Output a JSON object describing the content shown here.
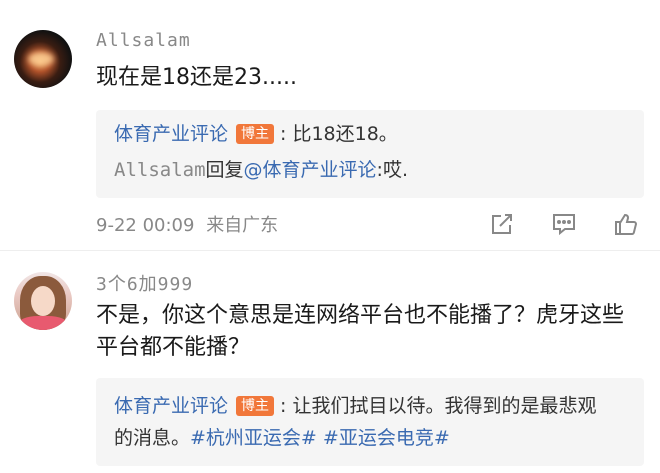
{
  "comments": [
    {
      "username": "Allsalam",
      "text": "现在是18还是23.....",
      "replies": [
        {
          "name": "体育产业评论",
          "badge": "博主",
          "text": ": 比18还18。"
        },
        {
          "name": "Allsalam",
          "verb": "回复",
          "target": "@体育产业评论",
          "text": ":哎."
        }
      ],
      "timestamp": "9-22 00:09",
      "location": "来自广东",
      "icons": [
        "share-icon",
        "comment-icon",
        "like-icon"
      ]
    },
    {
      "username": "3个6加999",
      "text": "不是，你这个意思是连网络平台也不能播了？虎牙这些平台都不能播？",
      "quote": {
        "name": "体育产业评论",
        "badge": "博主",
        "text1": ": 让我们拭目以待。我得到的是最悲观",
        "text2": "的消息。",
        "tags": [
          "#杭州亚运会#",
          "#亚运会电竞#"
        ]
      }
    }
  ],
  "colors": {
    "link": "#3a6ab1",
    "badge": "#f1773a",
    "quote_bg": "#f5f5f5",
    "meta": "#888888"
  }
}
